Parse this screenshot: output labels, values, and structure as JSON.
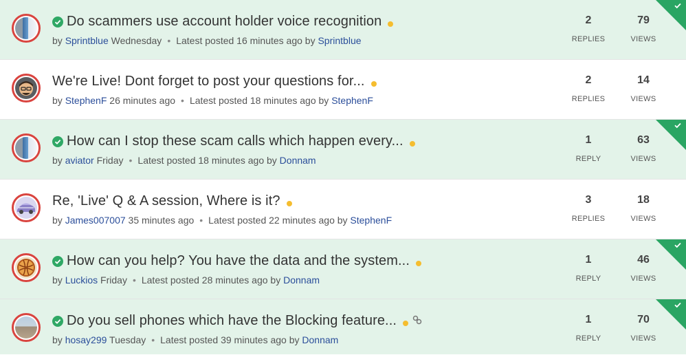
{
  "colors": {
    "solved_bg": "#e3f3e9",
    "accent_green": "#2aa563",
    "user_link": "#2b4e9a",
    "new_dot": "#f5bd2f",
    "avatar_ring": "#d9443f"
  },
  "threads": [
    {
      "title": "Do scammers use account holder voice recognition",
      "solved": true,
      "has_link_icon": false,
      "author": "Sprintblue",
      "posted": "Wednesday",
      "latest_label": "Latest posted 16 minutes ago by",
      "latest_user": "Sprintblue",
      "replies": "2",
      "replies_label": "REPLIES",
      "views": "79",
      "views_label": "VIEWS",
      "avatar": "phone-avatar"
    },
    {
      "title": "We're Live! Dont forget to post your questions for...",
      "solved": false,
      "has_link_icon": false,
      "author": "StephenF",
      "posted": "26 minutes ago",
      "latest_label": "Latest posted 18 minutes ago by",
      "latest_user": "StephenF",
      "replies": "2",
      "replies_label": "REPLIES",
      "views": "14",
      "views_label": "VIEWS",
      "avatar": "person-avatar"
    },
    {
      "title": "How can I stop these scam calls which happen every...",
      "solved": true,
      "has_link_icon": false,
      "author": "aviator",
      "posted": "Friday",
      "latest_label": "Latest posted 18 minutes ago by",
      "latest_user": "Donnam",
      "replies": "1",
      "replies_label": "REPLY",
      "views": "63",
      "views_label": "VIEWS",
      "avatar": "phone-avatar"
    },
    {
      "title": "Re, 'Live' Q & A session, Where is it?",
      "solved": false,
      "has_link_icon": false,
      "author": "James007007",
      "posted": "35 minutes ago",
      "latest_label": "Latest posted 22 minutes ago by",
      "latest_user": "StephenF",
      "replies": "3",
      "replies_label": "REPLIES",
      "views": "18",
      "views_label": "VIEWS",
      "avatar": "car-avatar"
    },
    {
      "title": "How can you help? You have the data and the system...",
      "solved": true,
      "has_link_icon": false,
      "author": "Luckios",
      "posted": "Friday",
      "latest_label": "Latest posted 28 minutes ago by",
      "latest_user": "Donnam",
      "replies": "1",
      "replies_label": "REPLY",
      "views": "46",
      "views_label": "VIEWS",
      "avatar": "ball-avatar"
    },
    {
      "title": "Do you sell phones which have the Blocking feature...",
      "solved": true,
      "has_link_icon": true,
      "author": "hosay299",
      "posted": "Tuesday",
      "latest_label": "Latest posted 39 minutes ago by",
      "latest_user": "Donnam",
      "replies": "1",
      "replies_label": "REPLY",
      "views": "70",
      "views_label": "VIEWS",
      "avatar": "beach-avatar"
    }
  ],
  "by_label": "by"
}
